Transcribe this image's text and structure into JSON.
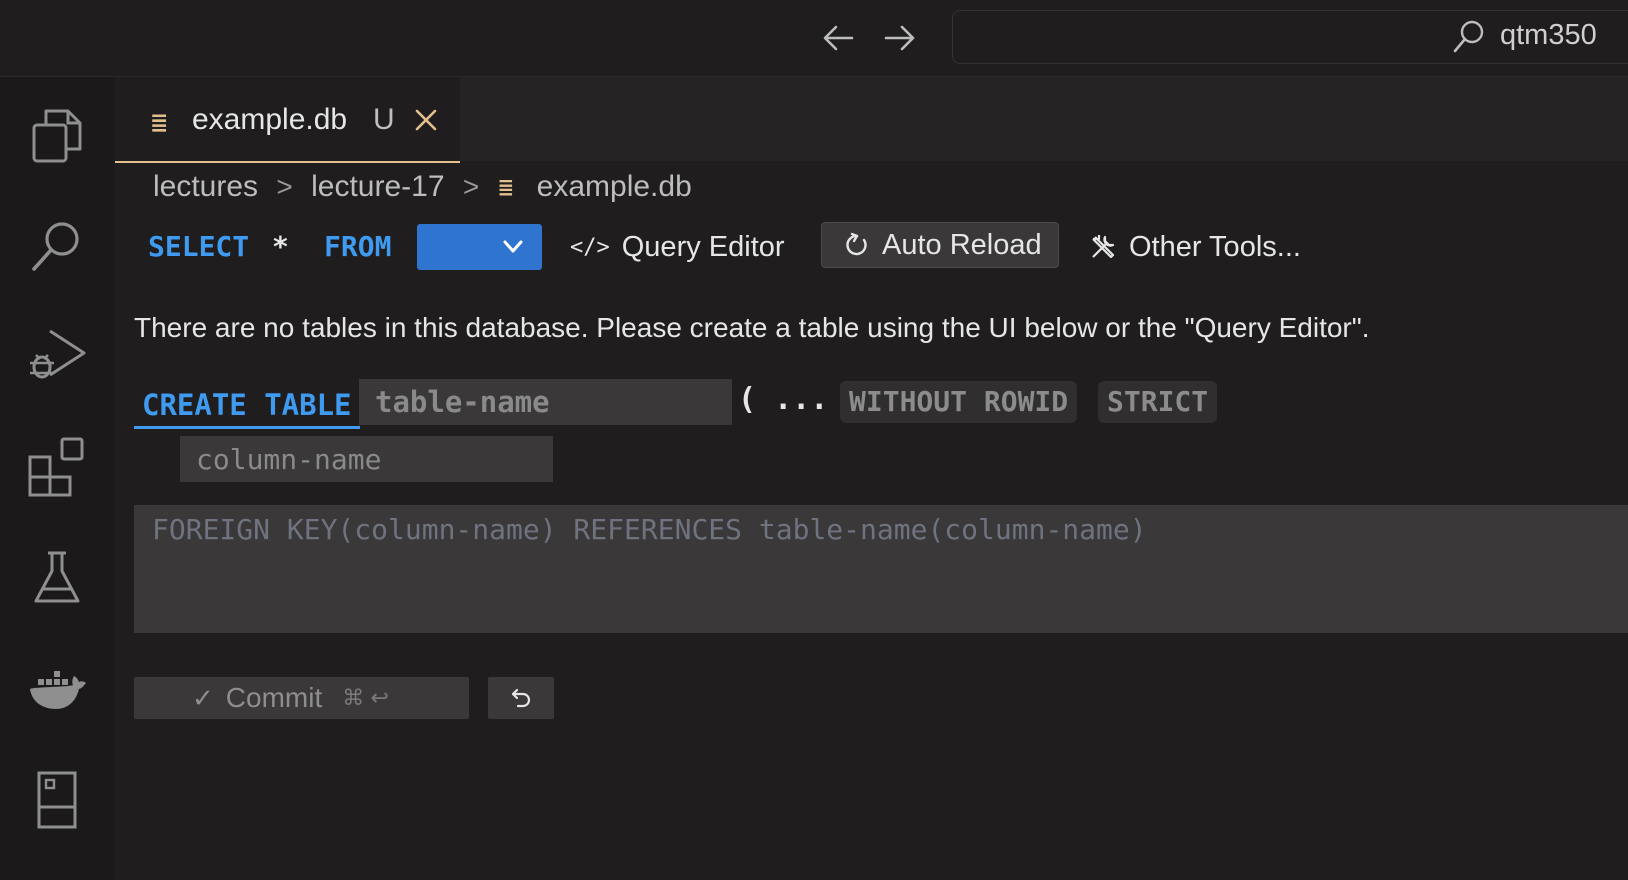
{
  "titlebar": {
    "search_text": "qtm350"
  },
  "activitybar": {
    "icons": [
      "files-icon",
      "search-icon",
      "run-debug-icon",
      "extensions-icon",
      "testing-icon",
      "docker-icon",
      "remote-explorer-icon"
    ]
  },
  "tab": {
    "label": "example.db",
    "status": "U",
    "file_icon": "≣"
  },
  "breadcrumb": {
    "items": [
      "lectures",
      "lecture-17",
      "example.db"
    ],
    "separator": ">",
    "file_icon": "≣"
  },
  "toolbar": {
    "select_kw": "SELECT",
    "star": "*",
    "from_kw": "FROM",
    "query_editor_icon": "</>",
    "query_editor_label": "Query Editor",
    "auto_reload_label": "Auto Reload",
    "other_tools_label": "Other Tools..."
  },
  "message": "There are no tables in this database. Please create a table using the UI below or the \"Query Editor\".",
  "create_table": {
    "keyword": "CREATE TABLE",
    "table_name_placeholder": "table-name",
    "paren": "( ... )",
    "without_rowid": "WITHOUT ROWID",
    "strict": "STRICT",
    "column_name_placeholder": "column-name",
    "constraints_placeholder": "FOREIGN KEY(column-name) REFERENCES table-name(column-name)"
  },
  "actions": {
    "commit_check": "✓",
    "commit_label": "Commit",
    "commit_shortcut": "⌘ ↩"
  },
  "colors": {
    "background": "#1f1d1d",
    "keyword_blue": "#3f9bf0",
    "select_blue": "#2f75d0",
    "tab_accent": "#e2c08d",
    "input_bg": "#3a3838"
  }
}
